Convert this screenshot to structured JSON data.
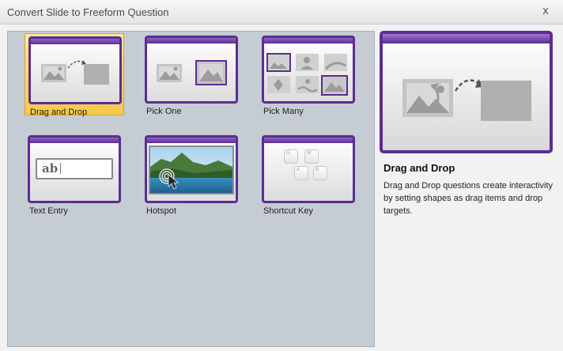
{
  "window": {
    "title": "Convert Slide to Freeform Question",
    "close_glyph": "x"
  },
  "question_types": [
    {
      "label": "Drag and Drop",
      "icon": "drag-and-drop-icon",
      "selected": true
    },
    {
      "label": "Pick One",
      "icon": "pick-one-icon",
      "selected": false
    },
    {
      "label": "Pick Many",
      "icon": "pick-many-icon",
      "selected": false
    },
    {
      "label": "Text Entry",
      "icon": "text-entry-icon",
      "selected": false
    },
    {
      "label": "Hotspot",
      "icon": "hotspot-icon",
      "selected": false
    },
    {
      "label": "Shortcut Key",
      "icon": "shortcut-key-icon",
      "selected": false
    }
  ],
  "text_entry_sample": "ab",
  "shortcut_keys": [
    "G",
    "W",
    "A",
    "B"
  ],
  "detail": {
    "title": "Drag and Drop",
    "description": "Drag and Drop questions create interactivity by setting shapes as drag items and drop targets."
  },
  "colors": {
    "accent_purple": "#5c2d91",
    "selection_yellow": "#f5c94a",
    "gallery_bg": "#c6ccd3"
  }
}
